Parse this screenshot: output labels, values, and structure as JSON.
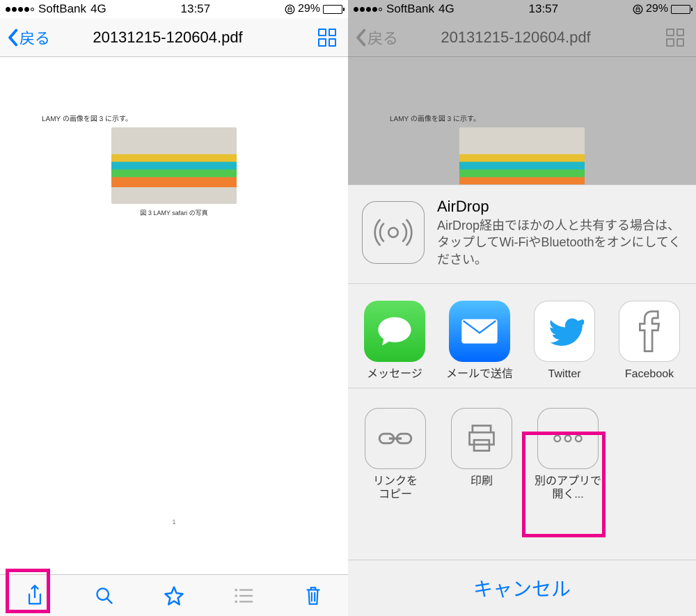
{
  "status": {
    "carrier": "SoftBank",
    "network": "4G",
    "time": "13:57",
    "battery_pct": "29%"
  },
  "nav": {
    "back_label": "戻る",
    "title": "20131215-120604.pdf"
  },
  "document": {
    "heading": "LAMY の画像を図 3 に示す。",
    "caption": "図 3   LAMY safari の写真",
    "page_number": "1"
  },
  "share_sheet": {
    "airdrop_title": "AirDrop",
    "airdrop_desc": "AirDrop経由でほかの人と共有する場合は、タップしてWi-FiやBluetoothをオンにしてください。",
    "apps": [
      {
        "label": "メッセージ"
      },
      {
        "label": "メールで送信"
      },
      {
        "label": "Twitter"
      },
      {
        "label": "Facebook"
      }
    ],
    "actions": [
      {
        "label": "リンクを\nコピー"
      },
      {
        "label": "印刷"
      },
      {
        "label": "別のアプリで\n開く..."
      }
    ],
    "cancel": "キャンセル"
  }
}
